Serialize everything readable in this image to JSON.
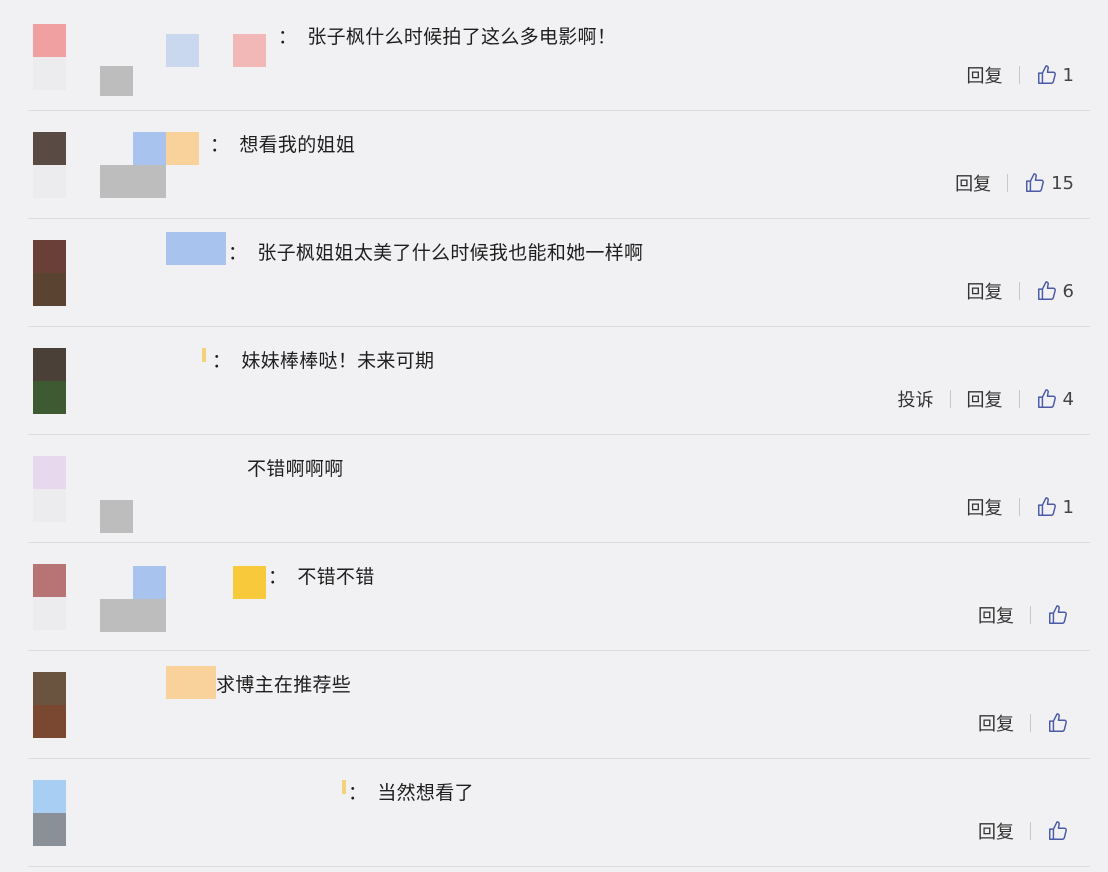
{
  "colors": {
    "background": "#f1f1f3",
    "divider": "#dcdcde",
    "text": "#1e1e1e"
  },
  "actions": {
    "reply_label": "回复",
    "report_label": "投诉",
    "like_icon": "thumbs-up-icon"
  },
  "comments": [
    {
      "text": "张子枫什么时候拍了这么多电影啊！",
      "colon": "：",
      "likes": "1",
      "report": ""
    },
    {
      "text": "想看我的姐姐",
      "colon": "：",
      "likes": "15",
      "report": ""
    },
    {
      "text": "张子枫姐姐太美了什么时候我也能和她一样啊",
      "colon": "：",
      "likes": "6",
      "report": ""
    },
    {
      "text": "妹妹棒棒哒！未来可期",
      "colon": "：",
      "likes": "4",
      "report": "投诉"
    },
    {
      "text": "不错啊啊啊",
      "colon": "",
      "likes": "1",
      "report": ""
    },
    {
      "text": "不错不错",
      "colon": "：",
      "likes": "",
      "report": ""
    },
    {
      "text": "求博主在推荐些",
      "colon": "",
      "likes": "",
      "report": ""
    },
    {
      "text": "当然想看了",
      "colon": "：",
      "likes": "",
      "report": ""
    }
  ]
}
